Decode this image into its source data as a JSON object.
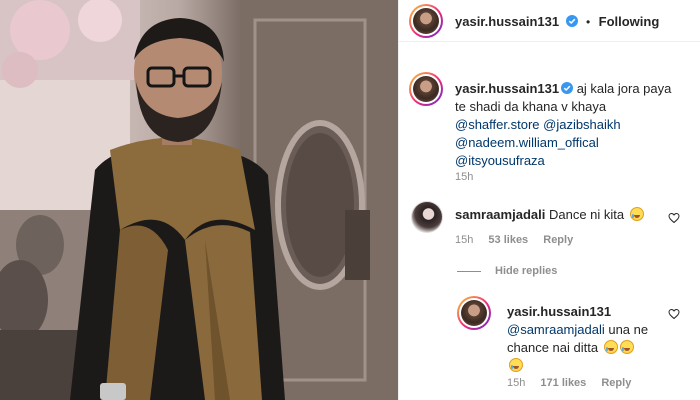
{
  "post": {
    "author": "yasir.hussain131",
    "follow_status": "Following",
    "separator": "•"
  },
  "caption": {
    "author": "yasir.hussain131",
    "text": "aj kala jora paya te shadi da khana v khaya",
    "mentions": [
      "@shaffer.store",
      "@jazibshaikh",
      "@nadeem.william_offical",
      "@itsyousufraza"
    ],
    "time": "15h"
  },
  "comments": [
    {
      "author": "samraamjadali",
      "text": "Dance ni kita",
      "time": "15h",
      "likes": "53 likes",
      "reply_label": "Reply"
    }
  ],
  "replies_toggle": "Hide replies",
  "reply": {
    "author": "yasir.hussain131",
    "mention": "@samraamjadali",
    "text_line1": " una ne",
    "text_line2": "chance nai ditta",
    "time": "15h",
    "likes": "171 likes",
    "reply_label": "Reply"
  },
  "colors": {
    "link": "#00376b",
    "verified": "#3897f0",
    "muted": "#8e8e8e"
  },
  "icons": [
    "verified-badge-icon",
    "heart-icon",
    "laughing-emoji-icon"
  ]
}
